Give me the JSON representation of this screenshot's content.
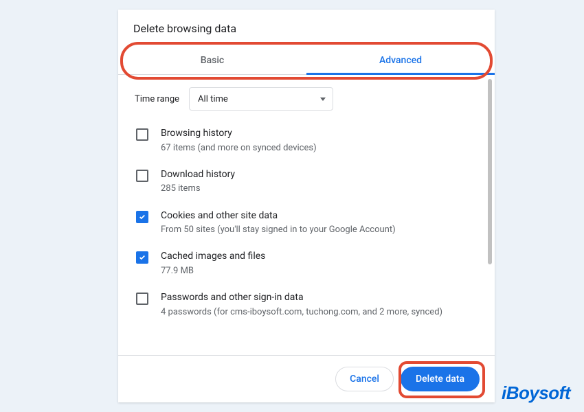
{
  "dialog": {
    "title": "Delete browsing data",
    "tabs": {
      "basic": "Basic",
      "advanced": "Advanced"
    },
    "time_range": {
      "label": "Time range",
      "value": "All time"
    },
    "items": [
      {
        "title": "Browsing history",
        "sub": "67 items (and more on synced devices)",
        "checked": false
      },
      {
        "title": "Download history",
        "sub": "285 items",
        "checked": false
      },
      {
        "title": "Cookies and other site data",
        "sub": "From 50 sites (you'll stay signed in to your Google Account)",
        "checked": true
      },
      {
        "title": "Cached images and files",
        "sub": "77.9 MB",
        "checked": true
      },
      {
        "title": "Passwords and other sign-in data",
        "sub": "4 passwords (for cms-iboysoft.com, tuchong.com, and 2 more, synced)",
        "checked": false
      }
    ],
    "buttons": {
      "cancel": "Cancel",
      "delete": "Delete data"
    }
  },
  "watermark": "iBoysoft"
}
